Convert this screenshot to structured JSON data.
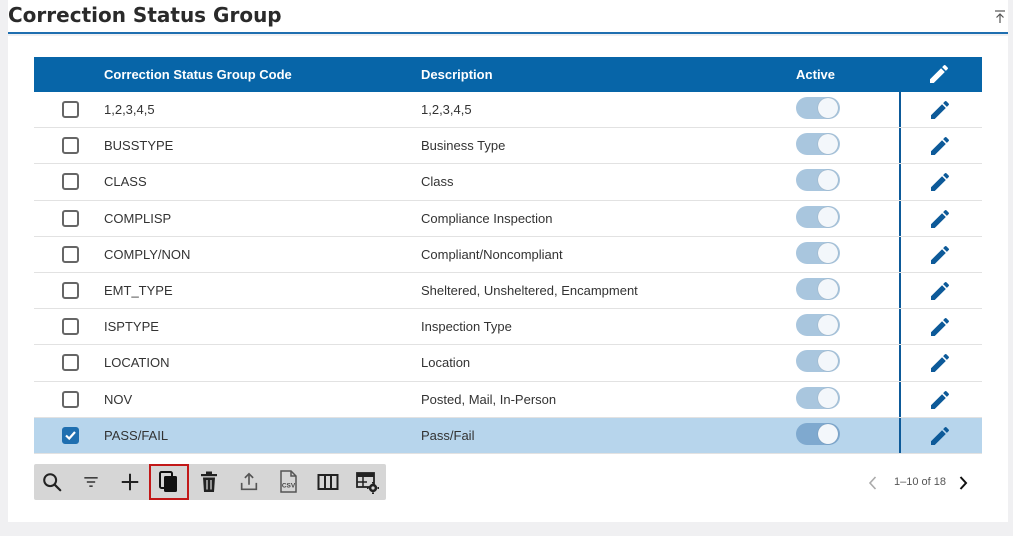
{
  "page": {
    "title": "Correction Status Group"
  },
  "grid": {
    "headers": {
      "code": "Correction Status Group Code",
      "description": "Description",
      "active": "Active"
    },
    "rows": [
      {
        "code": "1,2,3,4,5",
        "description": "1,2,3,4,5",
        "active": true,
        "checked": false
      },
      {
        "code": "BUSSTYPE",
        "description": "Business Type",
        "active": true,
        "checked": false
      },
      {
        "code": "CLASS",
        "description": "Class",
        "active": true,
        "checked": false
      },
      {
        "code": "COMPLISP",
        "description": "Compliance Inspection",
        "active": true,
        "checked": false
      },
      {
        "code": "COMPLY/NON",
        "description": "Compliant/Noncompliant",
        "active": true,
        "checked": false
      },
      {
        "code": "EMT_TYPE",
        "description": "Sheltered, Unsheltered, Encampment",
        "active": true,
        "checked": false
      },
      {
        "code": "ISPTYPE",
        "description": "Inspection Type",
        "active": true,
        "checked": false
      },
      {
        "code": "LOCATION",
        "description": "Location",
        "active": true,
        "checked": false
      },
      {
        "code": "NOV",
        "description": "Posted, Mail, In-Person",
        "active": true,
        "checked": false
      },
      {
        "code": "PASS/FAIL",
        "description": "Pass/Fail",
        "active": true,
        "checked": true
      }
    ]
  },
  "toolbar": {
    "buttons": [
      {
        "name": "search-button",
        "icon": "search-icon"
      },
      {
        "name": "filter-button",
        "icon": "filter-icon"
      },
      {
        "name": "add-button",
        "icon": "plus-icon"
      },
      {
        "name": "copy-button",
        "icon": "copy-icon",
        "highlighted": true
      },
      {
        "name": "delete-button",
        "icon": "trash-icon"
      },
      {
        "name": "export-button",
        "icon": "upload-icon"
      },
      {
        "name": "csv-export-button",
        "icon": "csv-icon",
        "csv_label": "CSV"
      },
      {
        "name": "columns-button",
        "icon": "columns-icon"
      },
      {
        "name": "table-settings-button",
        "icon": "table-gear-icon"
      }
    ]
  },
  "pager": {
    "range_text": "1–10 of 18"
  },
  "colors": {
    "header_bg": "#0765a8",
    "accent": "#1f6fb0",
    "selected_row": "#b7d5ec",
    "highlight_border": "#c21818"
  }
}
